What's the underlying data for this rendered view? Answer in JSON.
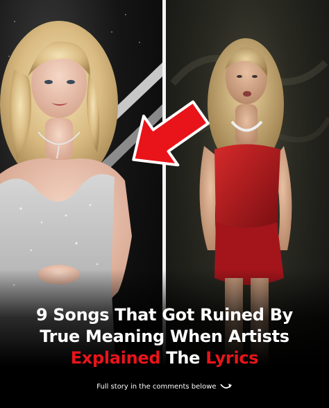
{
  "headline": {
    "line1": "9 Songs That Got Ruined By",
    "line2": "True Meaning When Artists",
    "line3_red1": "Explained",
    "line3_white": "The",
    "line3_red2": "Lyrics"
  },
  "footer": {
    "text": "Full story in the comments belowe"
  },
  "colors": {
    "accent_red": "#e8141a",
    "text_white": "#ffffff",
    "background": "#000000"
  },
  "icons": {
    "pointer_arrow": "red-arrow-icon",
    "footer_arrow": "curved-arrow-icon"
  }
}
